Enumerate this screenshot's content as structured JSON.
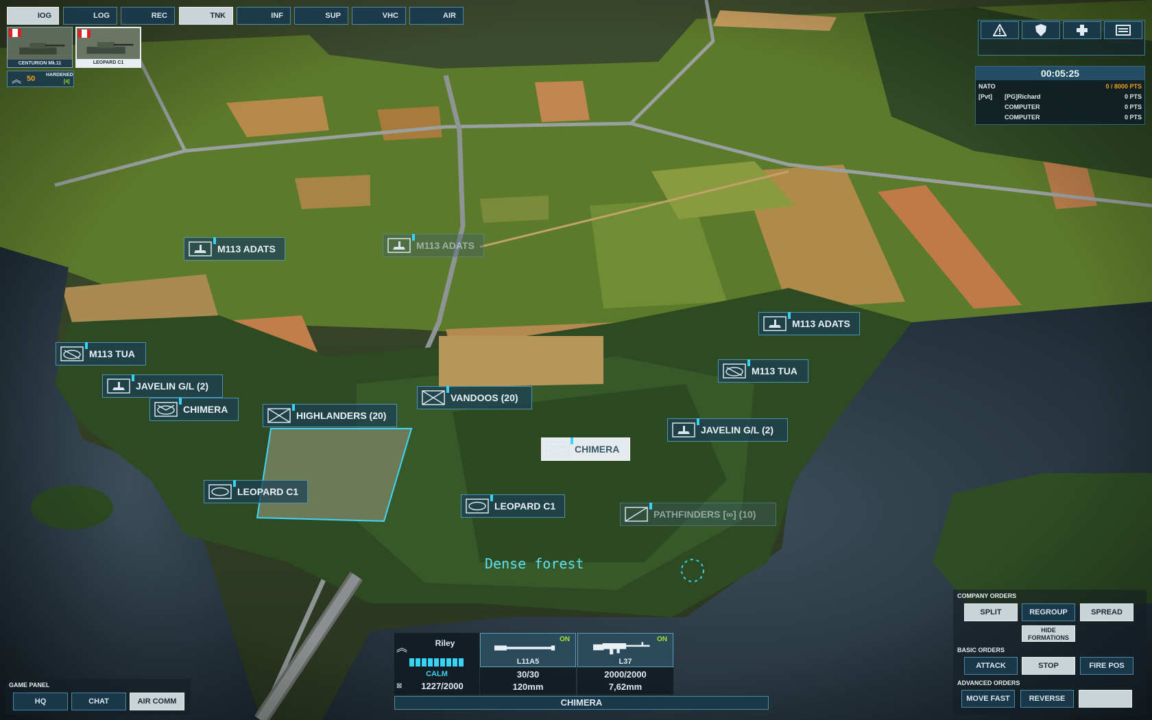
{
  "category_tabs": [
    {
      "label": "IOG",
      "active": true
    },
    {
      "label": "LOG",
      "active": false
    },
    {
      "label": "REC",
      "active": false
    },
    {
      "label": "TNK",
      "active": true
    },
    {
      "label": "INF",
      "active": false
    },
    {
      "label": "SUP",
      "active": false
    },
    {
      "label": "VHC",
      "active": false
    },
    {
      "label": "AIR",
      "active": false
    }
  ],
  "deck_cards": [
    {
      "name": "CENTURION Mk.11",
      "flag": "canada-flag"
    },
    {
      "name": "LEOPARD C1",
      "flag": "canada-flag"
    }
  ],
  "veterancy": {
    "value": "50",
    "label": "HARDENED",
    "count": "[4]"
  },
  "top_right_buttons": [
    "warning-icon",
    "shield-icon",
    "plus-icon",
    "keyboard-icon"
  ],
  "scoreboard": {
    "timer": "00:05:25",
    "faction": "NATO",
    "faction_points": "0 / 8000 PTS",
    "players": [
      {
        "rank": "[Pvt]",
        "name": "[PG]Richard",
        "points": "0 PTS"
      },
      {
        "rank": "",
        "name": "COMPUTER",
        "points": "0 PTS"
      },
      {
        "rank": "",
        "name": "COMPUTER",
        "points": "0 PTS"
      }
    ]
  },
  "units": [
    {
      "label": "M113 ADATS",
      "icon": "aa-vehicle-icon",
      "style": "normal"
    },
    {
      "label": "M113 ADATS",
      "icon": "aa-vehicle-icon",
      "style": "faded"
    },
    {
      "label": "M113 ADATS",
      "icon": "aa-vehicle-icon",
      "style": "normal"
    },
    {
      "label": "M113 TUA",
      "icon": "atgm-vehicle-icon",
      "style": "normal"
    },
    {
      "label": "M113 TUA",
      "icon": "atgm-vehicle-icon",
      "style": "normal"
    },
    {
      "label": "JAVELIN G/L (2)",
      "icon": "aa-vehicle-icon",
      "style": "normal"
    },
    {
      "label": "JAVELIN G/L (2)",
      "icon": "aa-vehicle-icon",
      "style": "normal"
    },
    {
      "label": "CHIMERA",
      "icon": "transport-vehicle-icon",
      "style": "normal"
    },
    {
      "label": "CHIMERA",
      "icon": "transport-vehicle-icon",
      "style": "selected"
    },
    {
      "label": "HIGHLANDERS (20)",
      "icon": "infantry-icon",
      "style": "normal"
    },
    {
      "label": "VANDOOS (20)",
      "icon": "infantry-icon",
      "style": "normal"
    },
    {
      "label": "LEOPARD C1",
      "icon": "tank-icon",
      "style": "normal"
    },
    {
      "label": "LEOPARD C1",
      "icon": "tank-icon",
      "style": "normal"
    },
    {
      "label": "PATHFINDERS [∞] (10)",
      "icon": "recon-infantry-icon",
      "style": "faded"
    }
  ],
  "terrain_tooltip": "Dense forest",
  "company_orders": {
    "title": "COMPANY ORDERS",
    "buttons": [
      "SPLIT",
      "REGROUP",
      "SPREAD"
    ],
    "hide_formations": "HIDE FORMATIONS"
  },
  "basic_orders": {
    "title": "BASIC ORDERS",
    "buttons": [
      "ATTACK",
      "STOP",
      "FIRE POS"
    ]
  },
  "advanced_orders": {
    "title": "ADVANCED ORDERS",
    "buttons": [
      "MOVE FAST",
      "REVERSE",
      ""
    ]
  },
  "game_panel": {
    "title": "GAME PANEL",
    "buttons": [
      "HQ",
      "CHAT",
      "AIR COMM"
    ]
  },
  "unit_panel": {
    "commander": "Riley",
    "morale": "CALM",
    "health_fraction": 1.0,
    "hp": "1227/2000",
    "weapons": [
      {
        "name": "L11A5",
        "status": "ON",
        "ammo": "30/30",
        "caliber": "120mm",
        "icon": "cannon-icon"
      },
      {
        "name": "L37",
        "status": "ON",
        "ammo": "2000/2000",
        "caliber": "7,62mm",
        "icon": "machine-gun-icon"
      }
    ],
    "unit_name": "CHIMERA"
  },
  "colors": {
    "accent": "#39d4f5",
    "orange": "#f2a21b",
    "on_green": "#a6e22e",
    "panel": "#12263a"
  }
}
